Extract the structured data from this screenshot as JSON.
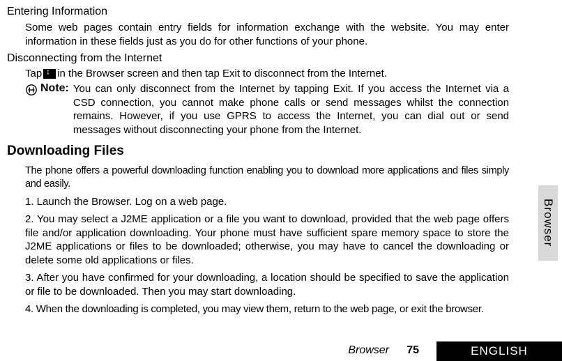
{
  "section1": {
    "title": "Entering Information",
    "body": "Some web pages contain entry fields for information exchange with the website. You may enter information in these fields just as you do for other functions of your phone."
  },
  "section2": {
    "title": "Disconnecting from the Internet",
    "tap_prefix": "Tap ",
    "tap_suffix": " in the Browser screen and then tap Exit to disconnect from the Internet.",
    "note_label": "Note:",
    "note_text": "You can only disconnect from the Internet by tapping Exit. If you access the Internet via a CSD connection, you cannot make phone calls or send messages whilst the connection remains. However, if you use GPRS to access the Internet, you can dial out or send messages without disconnecting your phone from the Internet."
  },
  "section3": {
    "title": "Downloading Files",
    "intro": "The phone offers a powerful downloading function enabling you to download more applications and files simply and easily.",
    "items": [
      "1. Launch the Browser. Log on a web page.",
      "2. You may select a J2ME application or a file you want to download, provided that the web page offers file and/or application downloading. Your phone must have sufficient spare memory space to store the J2ME applications or files to be downloaded; otherwise, you may have to cancel the downloading or delete some old applications or files.",
      "3. After you have confirmed for your downloading, a location should be specified to save the application or file to be downloaded. Then you may start downloading.",
      "4. When the downloading is completed, you may view them, return to the web page, or exit the browser."
    ]
  },
  "sidetab": "Browser",
  "footer": {
    "section": "Browser",
    "page": "75",
    "lang": "ENGLISH"
  }
}
